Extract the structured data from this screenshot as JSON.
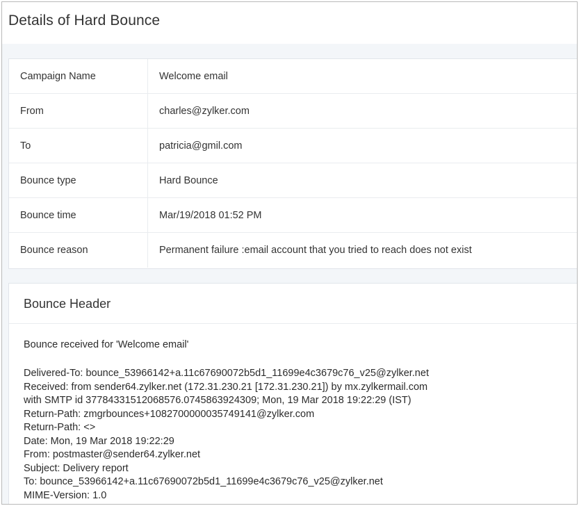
{
  "page": {
    "title": "Details of Hard Bounce"
  },
  "details": [
    {
      "label": "Campaign Name",
      "value": "Welcome email"
    },
    {
      "label": "From",
      "value": "charles@zylker.com"
    },
    {
      "label": "To",
      "value": "patricia@gmil.com"
    },
    {
      "label": "Bounce type",
      "value": "Hard Bounce"
    },
    {
      "label": "Bounce time",
      "value": "Mar/19/2018 01:52 PM"
    },
    {
      "label": "Bounce reason",
      "value": "Permanent failure :email account that you tried to reach does not exist"
    }
  ],
  "bounce_header": {
    "title": "Bounce Header",
    "intro": "Bounce received for 'Welcome email'",
    "lines": [
      "Delivered-To: bounce_53966142+a.11c67690072b5d1_11699e4c3679c76_v25@zylker.net",
      "Received: from sender64.zylker.net (172.31.230.21 [172.31.230.21]) by mx.zylkermail.com",
      "with SMTP id 37784331512068576.0745863924309; Mon, 19 Mar 2018 19:22:29 (IST)",
      "Return-Path: zmgrbounces+1082700000035749141@zylker.com",
      "Return-Path: <>",
      "Date: Mon, 19 Mar 2018 19:22:29",
      "From: postmaster@sender64.zylker.net",
      "Subject: Delivery report",
      "To: bounce_53966142+a.11c67690072b5d1_11699e4c3679c76_v25@zylker.net",
      "MIME-Version: 1.0"
    ]
  }
}
